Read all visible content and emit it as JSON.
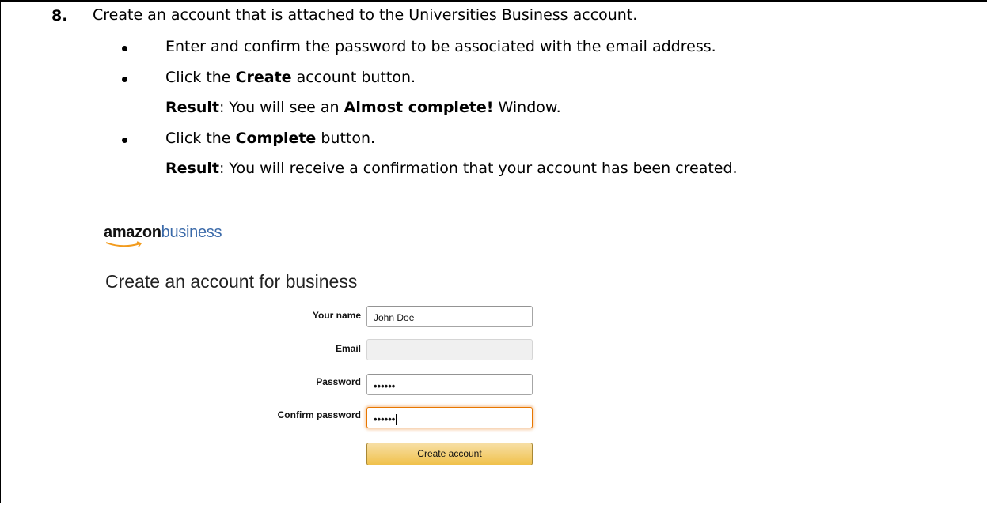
{
  "step": {
    "number": "8."
  },
  "instructions": {
    "intro": "Create an account that is attached to the Universities Business account.",
    "bullet1": "Enter and confirm the password to be associated with the email address.",
    "bullet2_pre": "Click the ",
    "bullet2_bold": "Create",
    "bullet2_post": " account button.",
    "result1_label": "Result",
    "result1_pre": ": You will see an ",
    "result1_bold": "Almost complete!",
    "result1_post": " Window.",
    "bullet3_pre": "Click the ",
    "bullet3_bold": "Complete",
    "bullet3_post": " button.",
    "result2_label": "Result",
    "result2_text": ": You will receive a confirmation that your account has been created."
  },
  "amazon": {
    "logo_bold": "amazon",
    "logo_light": "business",
    "form_title": "Create an account for business",
    "fields": {
      "name_label": "Your name",
      "name_value": "John Doe",
      "email_label": "Email",
      "email_value": "",
      "password_label": "Password",
      "password_value": "••••••",
      "confirm_label": "Confirm password",
      "confirm_value": "••••••"
    },
    "create_button": "Create account",
    "colors": {
      "logo_blue": "#3b6aa9",
      "button_yellow": "#f0c14b",
      "focus_orange": "#e77600"
    }
  }
}
